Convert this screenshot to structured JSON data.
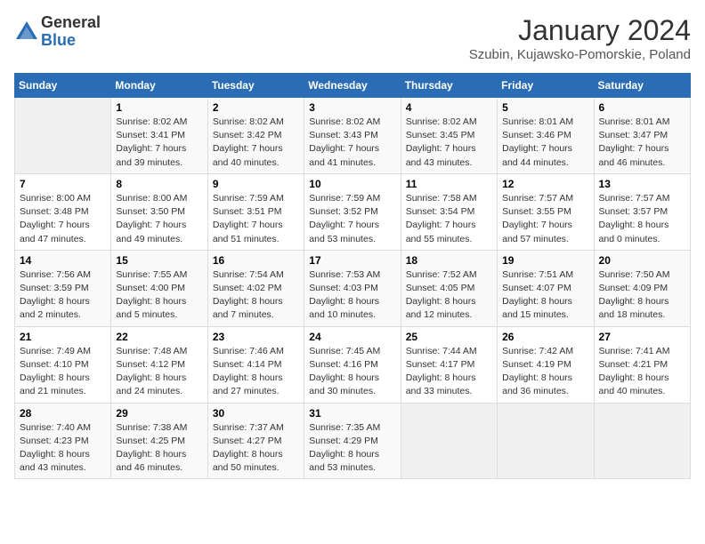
{
  "header": {
    "logo_general": "General",
    "logo_blue": "Blue",
    "month_title": "January 2024",
    "location": "Szubin, Kujawsko-Pomorskie, Poland"
  },
  "weekdays": [
    "Sunday",
    "Monday",
    "Tuesday",
    "Wednesday",
    "Thursday",
    "Friday",
    "Saturday"
  ],
  "weeks": [
    [
      {
        "day": "",
        "empty": true
      },
      {
        "day": "1",
        "sunrise": "Sunrise: 8:02 AM",
        "sunset": "Sunset: 3:41 PM",
        "daylight": "Daylight: 7 hours and 39 minutes."
      },
      {
        "day": "2",
        "sunrise": "Sunrise: 8:02 AM",
        "sunset": "Sunset: 3:42 PM",
        "daylight": "Daylight: 7 hours and 40 minutes."
      },
      {
        "day": "3",
        "sunrise": "Sunrise: 8:02 AM",
        "sunset": "Sunset: 3:43 PM",
        "daylight": "Daylight: 7 hours and 41 minutes."
      },
      {
        "day": "4",
        "sunrise": "Sunrise: 8:02 AM",
        "sunset": "Sunset: 3:45 PM",
        "daylight": "Daylight: 7 hours and 43 minutes."
      },
      {
        "day": "5",
        "sunrise": "Sunrise: 8:01 AM",
        "sunset": "Sunset: 3:46 PM",
        "daylight": "Daylight: 7 hours and 44 minutes."
      },
      {
        "day": "6",
        "sunrise": "Sunrise: 8:01 AM",
        "sunset": "Sunset: 3:47 PM",
        "daylight": "Daylight: 7 hours and 46 minutes."
      }
    ],
    [
      {
        "day": "7",
        "sunrise": "Sunrise: 8:00 AM",
        "sunset": "Sunset: 3:48 PM",
        "daylight": "Daylight: 7 hours and 47 minutes."
      },
      {
        "day": "8",
        "sunrise": "Sunrise: 8:00 AM",
        "sunset": "Sunset: 3:50 PM",
        "daylight": "Daylight: 7 hours and 49 minutes."
      },
      {
        "day": "9",
        "sunrise": "Sunrise: 7:59 AM",
        "sunset": "Sunset: 3:51 PM",
        "daylight": "Daylight: 7 hours and 51 minutes."
      },
      {
        "day": "10",
        "sunrise": "Sunrise: 7:59 AM",
        "sunset": "Sunset: 3:52 PM",
        "daylight": "Daylight: 7 hours and 53 minutes."
      },
      {
        "day": "11",
        "sunrise": "Sunrise: 7:58 AM",
        "sunset": "Sunset: 3:54 PM",
        "daylight": "Daylight: 7 hours and 55 minutes."
      },
      {
        "day": "12",
        "sunrise": "Sunrise: 7:57 AM",
        "sunset": "Sunset: 3:55 PM",
        "daylight": "Daylight: 7 hours and 57 minutes."
      },
      {
        "day": "13",
        "sunrise": "Sunrise: 7:57 AM",
        "sunset": "Sunset: 3:57 PM",
        "daylight": "Daylight: 8 hours and 0 minutes."
      }
    ],
    [
      {
        "day": "14",
        "sunrise": "Sunrise: 7:56 AM",
        "sunset": "Sunset: 3:59 PM",
        "daylight": "Daylight: 8 hours and 2 minutes."
      },
      {
        "day": "15",
        "sunrise": "Sunrise: 7:55 AM",
        "sunset": "Sunset: 4:00 PM",
        "daylight": "Daylight: 8 hours and 5 minutes."
      },
      {
        "day": "16",
        "sunrise": "Sunrise: 7:54 AM",
        "sunset": "Sunset: 4:02 PM",
        "daylight": "Daylight: 8 hours and 7 minutes."
      },
      {
        "day": "17",
        "sunrise": "Sunrise: 7:53 AM",
        "sunset": "Sunset: 4:03 PM",
        "daylight": "Daylight: 8 hours and 10 minutes."
      },
      {
        "day": "18",
        "sunrise": "Sunrise: 7:52 AM",
        "sunset": "Sunset: 4:05 PM",
        "daylight": "Daylight: 8 hours and 12 minutes."
      },
      {
        "day": "19",
        "sunrise": "Sunrise: 7:51 AM",
        "sunset": "Sunset: 4:07 PM",
        "daylight": "Daylight: 8 hours and 15 minutes."
      },
      {
        "day": "20",
        "sunrise": "Sunrise: 7:50 AM",
        "sunset": "Sunset: 4:09 PM",
        "daylight": "Daylight: 8 hours and 18 minutes."
      }
    ],
    [
      {
        "day": "21",
        "sunrise": "Sunrise: 7:49 AM",
        "sunset": "Sunset: 4:10 PM",
        "daylight": "Daylight: 8 hours and 21 minutes."
      },
      {
        "day": "22",
        "sunrise": "Sunrise: 7:48 AM",
        "sunset": "Sunset: 4:12 PM",
        "daylight": "Daylight: 8 hours and 24 minutes."
      },
      {
        "day": "23",
        "sunrise": "Sunrise: 7:46 AM",
        "sunset": "Sunset: 4:14 PM",
        "daylight": "Daylight: 8 hours and 27 minutes."
      },
      {
        "day": "24",
        "sunrise": "Sunrise: 7:45 AM",
        "sunset": "Sunset: 4:16 PM",
        "daylight": "Daylight: 8 hours and 30 minutes."
      },
      {
        "day": "25",
        "sunrise": "Sunrise: 7:44 AM",
        "sunset": "Sunset: 4:17 PM",
        "daylight": "Daylight: 8 hours and 33 minutes."
      },
      {
        "day": "26",
        "sunrise": "Sunrise: 7:42 AM",
        "sunset": "Sunset: 4:19 PM",
        "daylight": "Daylight: 8 hours and 36 minutes."
      },
      {
        "day": "27",
        "sunrise": "Sunrise: 7:41 AM",
        "sunset": "Sunset: 4:21 PM",
        "daylight": "Daylight: 8 hours and 40 minutes."
      }
    ],
    [
      {
        "day": "28",
        "sunrise": "Sunrise: 7:40 AM",
        "sunset": "Sunset: 4:23 PM",
        "daylight": "Daylight: 8 hours and 43 minutes."
      },
      {
        "day": "29",
        "sunrise": "Sunrise: 7:38 AM",
        "sunset": "Sunset: 4:25 PM",
        "daylight": "Daylight: 8 hours and 46 minutes."
      },
      {
        "day": "30",
        "sunrise": "Sunrise: 7:37 AM",
        "sunset": "Sunset: 4:27 PM",
        "daylight": "Daylight: 8 hours and 50 minutes."
      },
      {
        "day": "31",
        "sunrise": "Sunrise: 7:35 AM",
        "sunset": "Sunset: 4:29 PM",
        "daylight": "Daylight: 8 hours and 53 minutes."
      },
      {
        "day": "",
        "empty": true
      },
      {
        "day": "",
        "empty": true
      },
      {
        "day": "",
        "empty": true
      }
    ]
  ]
}
